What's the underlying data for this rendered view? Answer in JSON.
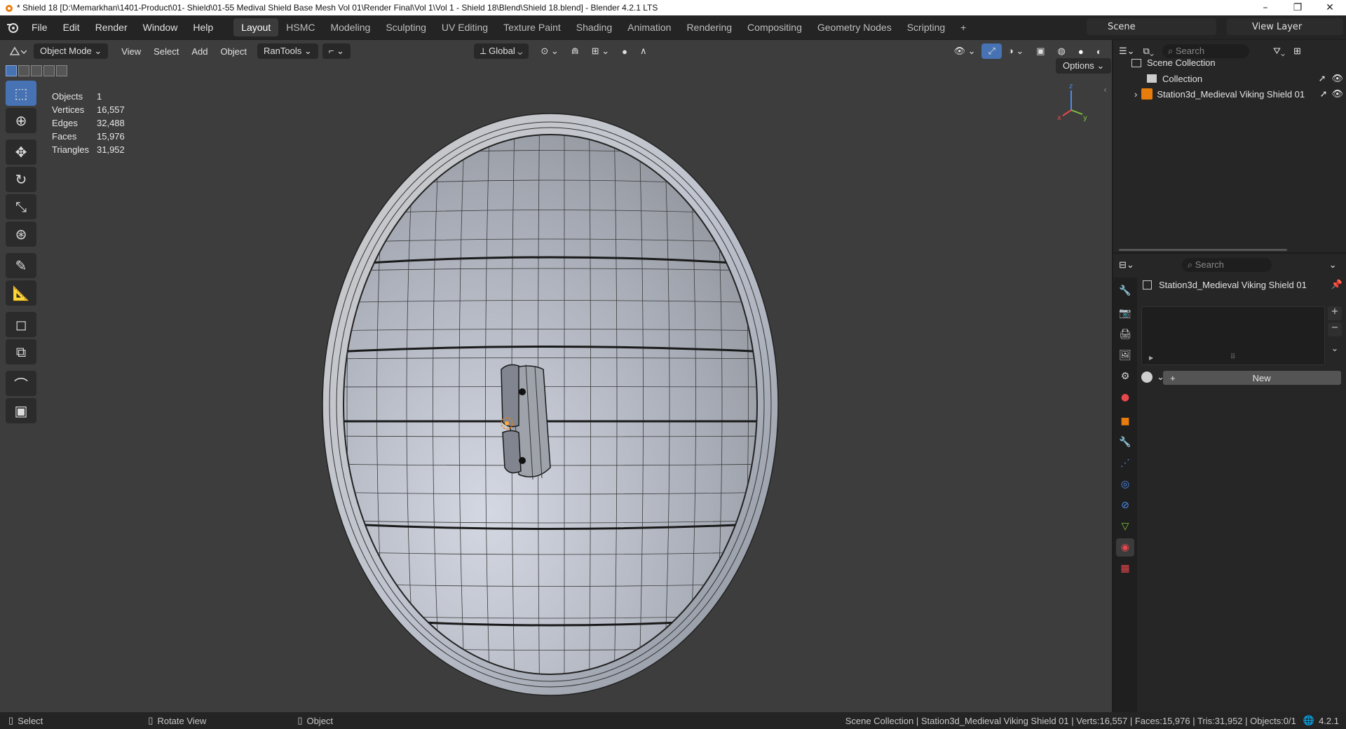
{
  "window": {
    "title": "* Shield 18 [D:\\Memarkhan\\1401-Product\\01- Shield\\01-55 Medival Shield Base Mesh Vol 01\\Render Final\\Vol 1\\Vol 1 - Shield 18\\Blend\\Shield 18.blend] - Blender 4.2.1 LTS",
    "min": "–",
    "max": "❐",
    "close": "✕"
  },
  "menus": [
    "File",
    "Edit",
    "Render",
    "Window",
    "Help"
  ],
  "workspaces": [
    "Layout",
    "HSMC",
    "Modeling",
    "Sculpting",
    "UV Editing",
    "Texture Paint",
    "Shading",
    "Animation",
    "Rendering",
    "Compositing",
    "Geometry Nodes",
    "Scripting"
  ],
  "active_workspace": "Layout",
  "add_workspace": "+",
  "scene": "Scene",
  "view_layer": "View Layer",
  "viewport_header": {
    "mode": "Object Mode",
    "view": "View",
    "select": "Select",
    "add": "Add",
    "object": "Object",
    "rantools": "RanTools",
    "transform": "Global",
    "options": "Options"
  },
  "stats": [
    {
      "label": "Objects",
      "value": "1"
    },
    {
      "label": "Vertices",
      "value": "16,557"
    },
    {
      "label": "Edges",
      "value": "32,488"
    },
    {
      "label": "Faces",
      "value": "15,976"
    },
    {
      "label": "Triangles",
      "value": "31,952"
    }
  ],
  "gizmo": {
    "x": "x",
    "y": "y",
    "z": "z"
  },
  "outliner": {
    "search": "Search",
    "scene_collection": "Scene Collection",
    "collection": "Collection",
    "object": "Station3d_Medieval Viking Shield 01"
  },
  "properties": {
    "search": "Search",
    "object_name": "Station3d_Medieval Viking Shield 01",
    "new_button": "New",
    "plus": "+"
  },
  "status": {
    "select": "Select",
    "rotate": "Rotate View",
    "object": "Object",
    "info": "Scene Collection | Station3d_Medieval Viking Shield 01 | Verts:16,557 | Faces:15,976 | Tris:31,952 | Objects:0/1",
    "version": "4.2.1"
  },
  "colors": {
    "accent": "#4772b3",
    "viewport_bg": "#3d3d3d",
    "panel_bg": "#262626"
  }
}
